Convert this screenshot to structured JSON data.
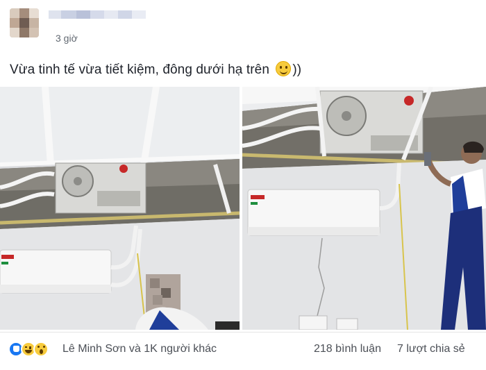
{
  "post": {
    "author_name": "",
    "timestamp": "3 giờ",
    "text": "Vừa tinh tế vừa tiết kiệm, đông dưới hạ trên",
    "text_suffix": "))",
    "emoji": "slightly-smiling-face-icon"
  },
  "photos": [
    {
      "name": "photo-left",
      "subject": "ceiling-ac-install-worker"
    },
    {
      "name": "photo-right",
      "subject": "ceiling-ac-install-worker-full"
    }
  ],
  "footer": {
    "reaction_icons": [
      "like-icon",
      "haha-icon",
      "wow-icon"
    ],
    "reactors": "Lê Minh Sơn và 1K người khác",
    "comments": "218 bình luận",
    "shares": "7 lượt chia sẻ"
  },
  "colors": {
    "like_blue": "#1877f2",
    "emoji_yellow": "#f7cb3d",
    "meta_gray": "#606770"
  }
}
